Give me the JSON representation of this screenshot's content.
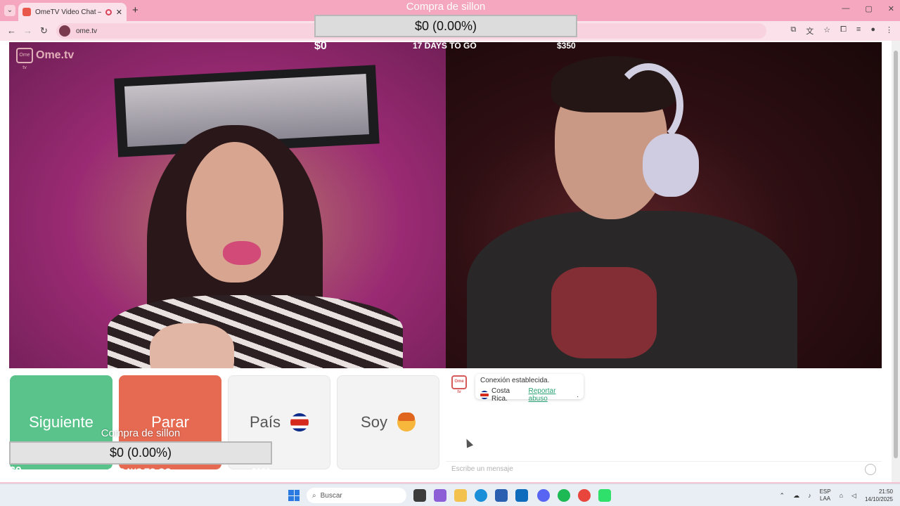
{
  "browser": {
    "tab_title": "OmeTV Video Chat — Ome",
    "tab_close": "✕",
    "new_tab": "+",
    "url": "ome.tv",
    "window_controls": [
      "—",
      "▢",
      "✕"
    ]
  },
  "donation_overlay": {
    "title": "Compra de sillon",
    "progress_text": "$0 (0.00%)",
    "progress_fraction": 0,
    "raised": "$0",
    "days_left": "17 DAYS TO GO",
    "goal": "$350"
  },
  "ome": {
    "brand": "Ome.tv",
    "brand_badge": "Ome tv",
    "buttons": {
      "next": "Siguiente",
      "stop": "Parar",
      "country": "País",
      "soy": "Soy"
    },
    "chat": {
      "message_line1": "Conexión establecida.",
      "country": "Costa Rica.",
      "report": "Reportar abuso",
      "report_suffix": ".",
      "input_placeholder": "Escribe un mensaje"
    }
  },
  "taskbar": {
    "search_placeholder": "Buscar",
    "language_line1": "ESP",
    "language_line2": "LAA",
    "time": "21:50",
    "date": "14/10/2025"
  },
  "colors": {
    "next_button": "#59c38b",
    "stop_button": "#e66a52",
    "browser_frame": "#f4a7bf",
    "report_link": "#2aa374"
  },
  "icons": [
    "back-icon",
    "forward-icon",
    "reload-icon",
    "star-icon",
    "extensions-icon",
    "costa-rica-flag-icon",
    "emoji-boy-icon",
    "smiley-icon",
    "windows-start-icon",
    "search-icon"
  ]
}
